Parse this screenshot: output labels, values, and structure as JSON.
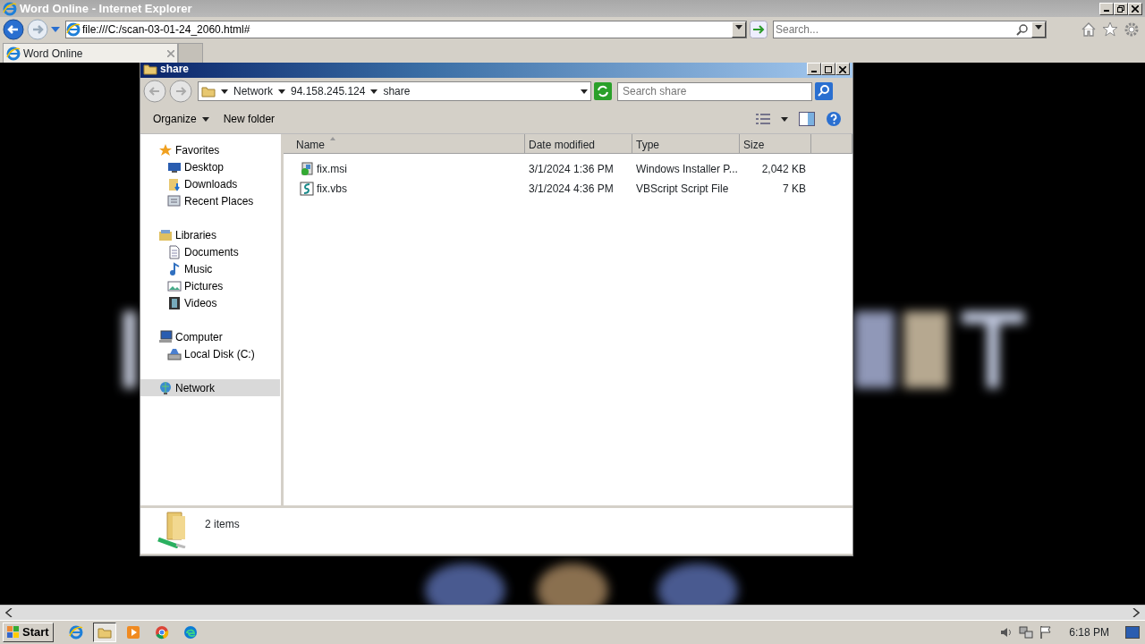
{
  "browser": {
    "title": "Word Online - Internet Explorer",
    "address": "file:///C:/scan-03-01-24_2060.html#",
    "search": {
      "placeholder": "Search..."
    },
    "tabs": [
      {
        "label": "Word Online",
        "selected": true
      }
    ]
  },
  "explorer": {
    "title": "share",
    "breadcrumb": [
      "Network",
      "94.158.245.124",
      "share"
    ],
    "search": {
      "placeholder": "Search share"
    },
    "toolbar": [
      {
        "label": "Organize",
        "dropdown": true
      },
      {
        "label": "New folder",
        "dropdown": false
      }
    ],
    "nav": [
      {
        "label": "Favorites",
        "kind": "star",
        "selected": false,
        "children": [
          {
            "label": "Desktop",
            "kind": "desktop",
            "selected": false
          },
          {
            "label": "Downloads",
            "kind": "downloads",
            "selected": false
          },
          {
            "label": "Recent Places",
            "kind": "recent",
            "selected": false
          }
        ]
      },
      {
        "label": "Libraries",
        "kind": "library",
        "selected": false,
        "children": [
          {
            "label": "Documents",
            "kind": "document",
            "selected": false
          },
          {
            "label": "Music",
            "kind": "music",
            "selected": false
          },
          {
            "label": "Pictures",
            "kind": "pictures",
            "selected": false
          },
          {
            "label": "Videos",
            "kind": "video",
            "selected": false
          }
        ]
      },
      {
        "label": "Computer",
        "kind": "computer",
        "selected": false,
        "children": [
          {
            "label": "Local Disk (C:)",
            "kind": "disk",
            "selected": false
          }
        ]
      },
      {
        "label": "Network",
        "kind": "network",
        "selected": true
      }
    ],
    "columns": [
      {
        "label": "Name",
        "sorted": true
      },
      {
        "label": "Date modified",
        "sorted": false
      },
      {
        "label": "Type",
        "sorted": false
      },
      {
        "label": "Size",
        "sorted": false
      }
    ],
    "files": [
      {
        "name": "fix.msi",
        "kind": "msi",
        "date": "3/1/2024 1:36 PM",
        "type": "Windows Installer P...",
        "size": "2,042 KB"
      },
      {
        "name": "fix.vbs",
        "kind": "vbs",
        "date": "3/1/2024 4:36 PM",
        "type": "VBScript Script File",
        "size": "7 KB"
      }
    ],
    "status": "2 items"
  },
  "taskbar": {
    "start": "Start",
    "apps": [
      {
        "kind": "ie",
        "selected": false
      },
      {
        "kind": "folder",
        "selected": true
      },
      {
        "kind": "player",
        "selected": false
      },
      {
        "kind": "chrome",
        "selected": false
      },
      {
        "kind": "edge",
        "selected": false
      }
    ],
    "clock": "6:18 PM"
  }
}
